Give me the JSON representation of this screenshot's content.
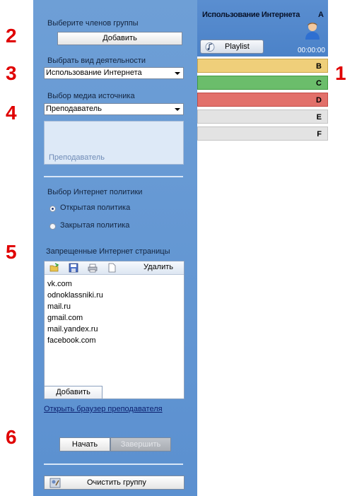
{
  "callouts": [
    "2",
    "3",
    "4",
    "5",
    "6",
    "1"
  ],
  "group_members": {
    "label": "Выберите членов группы",
    "add_button": "Добавить"
  },
  "activity": {
    "label": "Выбрать вид деятельности",
    "selected": "Использование Интернета"
  },
  "media_source": {
    "label": "Выбор медиа источника",
    "selected": "Преподаватель",
    "preview_text": "Преподаватель"
  },
  "internet_policy": {
    "label": "Выбор Интернет политики",
    "open": "Открытая политика",
    "closed": "Закрытая политика",
    "selected": "open"
  },
  "blocked_sites": {
    "label": "Запрещенные Интернет страницы",
    "delete_label": "Удалить",
    "items": [
      "vk.com",
      "odnoklassniki.ru",
      "mail.ru",
      "gmail.com",
      "mail.yandex.ru",
      "facebook.com"
    ],
    "add_button": "Добавить"
  },
  "open_browser_link": "Открыть браузер преподавателя",
  "controls": {
    "start": "Начать",
    "finish": "Завершить"
  },
  "clear_group": "Очистить группу",
  "right_panel": {
    "title": "Использование Интернета",
    "letter": "A",
    "playlist": "Playlist",
    "timer": "00:00:00",
    "rows": [
      {
        "letter": "B",
        "color": "#efcf7a"
      },
      {
        "letter": "C",
        "color": "#6bbd6b"
      },
      {
        "letter": "D",
        "color": "#e2706a"
      },
      {
        "letter": "E",
        "color": "#e3e3e3"
      },
      {
        "letter": "F",
        "color": "#e3e3e3"
      }
    ]
  }
}
